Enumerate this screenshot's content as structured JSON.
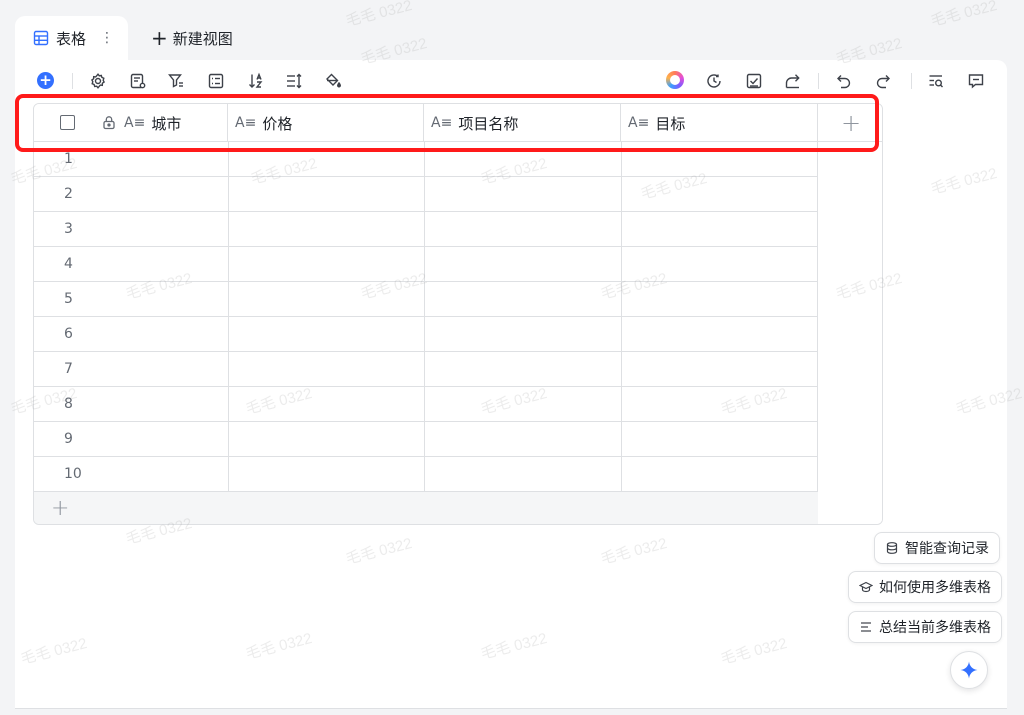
{
  "tabs": {
    "active_label": "表格",
    "kebab": "⋮",
    "new_view_label": "新建视图",
    "new_view_plus": "+"
  },
  "toolbar": {
    "icons": [
      "add-record-icon",
      "settings-icon",
      "field-config-icon",
      "filter-icon",
      "group-icon",
      "sort-icon",
      "row-height-icon",
      "fill-color-icon"
    ],
    "right_icons": [
      "ai-assistant-icon",
      "history-icon",
      "approval-icon",
      "share-icon",
      "undo-icon",
      "redo-icon",
      "search-icon",
      "comment-icon"
    ]
  },
  "table": {
    "columns": [
      {
        "type_icon": "A≡",
        "label": "城市",
        "primary": true
      },
      {
        "type_icon": "A≡",
        "label": "价格"
      },
      {
        "type_icon": "A≡",
        "label": "项目名称"
      },
      {
        "type_icon": "A≡",
        "label": "目标"
      }
    ],
    "add_column": "+",
    "rows": [
      "1",
      "2",
      "3",
      "4",
      "5",
      "6",
      "7",
      "8",
      "9",
      "10"
    ],
    "add_row": "+"
  },
  "assistant": {
    "chips": [
      {
        "icon": "database-icon",
        "label": "智能查询记录"
      },
      {
        "icon": "graduation-cap-icon",
        "label": "如何使用多维表格"
      },
      {
        "icon": "list-summary-icon",
        "label": "总结当前多维表格"
      }
    ],
    "fab_icon": "sparkle-icon"
  },
  "watermark": "毛毛 0322",
  "colors": {
    "accent": "#3370ff",
    "highlight": "#ff1a1a",
    "border": "#dee0e3"
  }
}
